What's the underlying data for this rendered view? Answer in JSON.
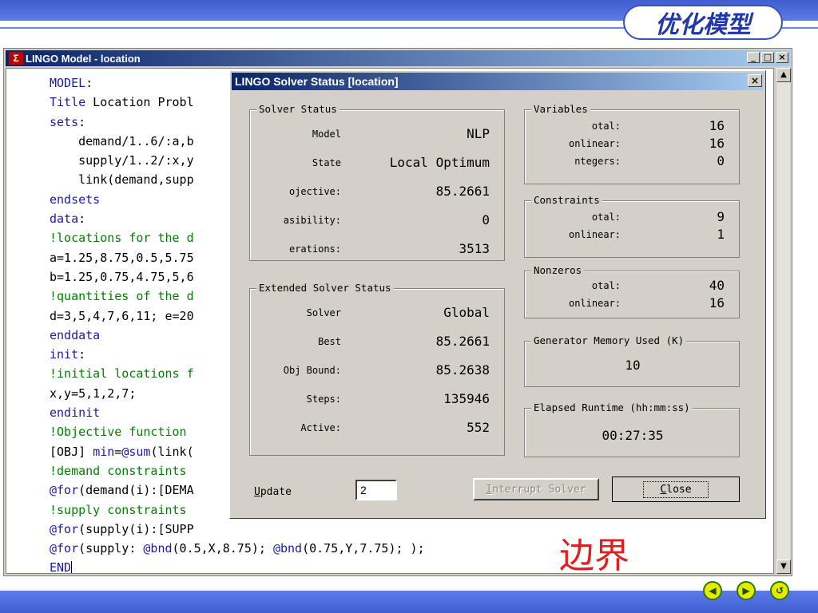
{
  "slide": {
    "title": "优化模型",
    "annotation": "边界",
    "nav": [
      "◀",
      "▶",
      "↺"
    ]
  },
  "model_window": {
    "title": "LINGO Model - location",
    "icon": "Σ",
    "controls": [
      "_",
      "□",
      "×"
    ],
    "code_lines": [
      [
        [
          "kw",
          "MODEL"
        ],
        [
          "t",
          ":"
        ]
      ],
      [
        [
          "kw",
          "Title"
        ],
        [
          "t",
          " Location Probl"
        ]
      ],
      [
        [
          "kw",
          "sets"
        ],
        [
          "t",
          ":"
        ]
      ],
      [
        [
          "t",
          "    demand/1..6/:a,b"
        ]
      ],
      [
        [
          "t",
          "    supply/1..2/:x,y"
        ]
      ],
      [
        [
          "t",
          "    link(demand,supp"
        ]
      ],
      [
        [
          "kw",
          "endsets"
        ]
      ],
      [
        [
          "kw",
          "data"
        ],
        [
          "t",
          ":"
        ]
      ],
      [
        [
          "cm",
          "!locations for the d"
        ]
      ],
      [
        [
          "t",
          "a=1.25,8.75,0.5,5.75"
        ]
      ],
      [
        [
          "t",
          "b=1.25,0.75,4.75,5,6"
        ]
      ],
      [
        [
          "cm",
          "!quantities of the d"
        ]
      ],
      [
        [
          "t",
          "d=3,5,4,7,6,11; e=20"
        ]
      ],
      [
        [
          "kw",
          "enddata"
        ]
      ],
      [
        [
          "kw",
          "init"
        ],
        [
          "t",
          ":"
        ]
      ],
      [
        [
          "cm",
          "!initial locations f"
        ]
      ],
      [
        [
          "t",
          "x,y=5,1,2,7;"
        ]
      ],
      [
        [
          "kw",
          "endinit"
        ]
      ],
      [
        [
          "cm",
          "!Objective function"
        ]
      ],
      [
        [
          "t",
          "[OBJ] "
        ],
        [
          "kw",
          "min"
        ],
        [
          "t",
          "="
        ],
        [
          "kw",
          "@sum"
        ],
        [
          "t",
          "(link("
        ]
      ],
      [
        [
          "cm",
          "!demand constraints"
        ]
      ],
      [
        [
          "kw",
          "@for"
        ],
        [
          "t",
          "(demand(i):[DEMA"
        ]
      ],
      [
        [
          "cm",
          "!supply constraints"
        ]
      ],
      [
        [
          "kw",
          "@for"
        ],
        [
          "t",
          "(supply(i):[SUPP"
        ]
      ],
      [
        [
          "kw",
          "@for"
        ],
        [
          "t",
          "(supply: "
        ],
        [
          "kw",
          "@bnd"
        ],
        [
          "t",
          "(0.5,X,8.75); "
        ],
        [
          "kw",
          "@bnd"
        ],
        [
          "t",
          "(0.75,Y,7.75); );"
        ]
      ],
      [
        [
          "kw",
          "END"
        ]
      ]
    ]
  },
  "dialog": {
    "title": "LINGO Solver Status [location]",
    "close_x": "×",
    "solver_status": {
      "title": "Solver Status",
      "rows": [
        {
          "label": "Model",
          "value": "NLP"
        },
        {
          "label": "State",
          "value": "Local Optimum"
        },
        {
          "label": "ojective:",
          "value": "85.2661"
        },
        {
          "label": "asibility:",
          "value": "0"
        },
        {
          "label": "erations:",
          "value": "3513"
        }
      ]
    },
    "extended_status": {
      "title": "Extended Solver Status",
      "rows": [
        {
          "label": "Solver",
          "value": "Global"
        },
        {
          "label": "Best",
          "value": "85.2661"
        },
        {
          "label": "Obj Bound:",
          "value": "85.2638"
        },
        {
          "label": "Steps:",
          "value": "135946"
        },
        {
          "label": "Active:",
          "value": "552"
        }
      ]
    },
    "variables": {
      "title": "Variables",
      "rows": [
        {
          "label": "otal:",
          "value": "16"
        },
        {
          "label": "onlinear:",
          "value": "16"
        },
        {
          "label": "ntegers:",
          "value": "0"
        }
      ]
    },
    "constraints": {
      "title": "Constraints",
      "rows": [
        {
          "label": "otal:",
          "value": "9"
        },
        {
          "label": "onlinear:",
          "value": "1"
        }
      ]
    },
    "nonzeros": {
      "title": "Nonzeros",
      "rows": [
        {
          "label": "otal:",
          "value": "40"
        },
        {
          "label": "onlinear:",
          "value": "16"
        }
      ]
    },
    "memory": {
      "title": "Generator Memory Used (K)",
      "value": "10"
    },
    "runtime": {
      "title": "Elapsed Runtime (hh:mm:ss)",
      "value": "00:27:35"
    },
    "update": {
      "label_u": "U",
      "label_rest": "pdate",
      "value": "2"
    },
    "buttons": {
      "interrupt_u": "I",
      "interrupt_rest": "nterrupt Solver",
      "close_u": "C",
      "close_rest": "lose"
    }
  }
}
